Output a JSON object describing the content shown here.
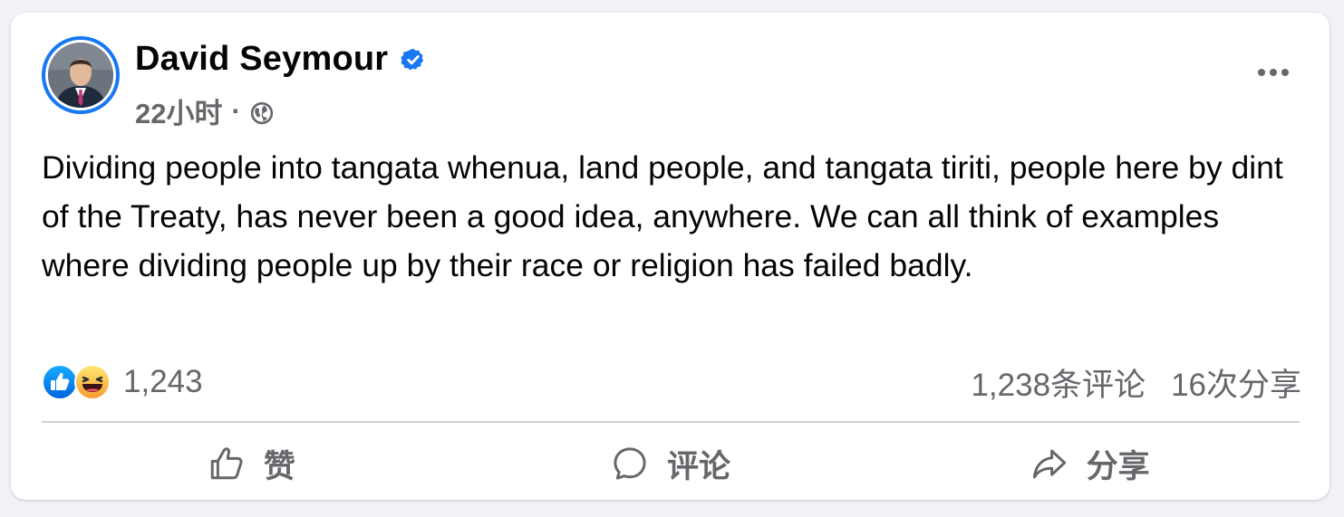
{
  "post": {
    "author": "David Seymour",
    "time": "22小时",
    "separator": "·",
    "text": "Dividing people into tangata whenua, land people, and tangata tiriti, people here by dint of the Treaty, has never been a good idea, anywhere. We can all think of examples where dividing people up by their race or religion has failed badly."
  },
  "stats": {
    "reaction_count": "1,243",
    "comments": "1,238条评论",
    "shares": "16次分享"
  },
  "actions": {
    "like": "赞",
    "comment": "评论",
    "share": "分享"
  },
  "icons": {
    "verified": "verified-badge-icon",
    "audience": "globe-icon",
    "more": "more-dots-icon",
    "like_reaction": "like-reaction-icon",
    "haha_reaction": "haha-reaction-icon"
  },
  "colors": {
    "accent": "#1877f2",
    "secondary_text": "#65676b",
    "background": "#f0f2f5"
  }
}
